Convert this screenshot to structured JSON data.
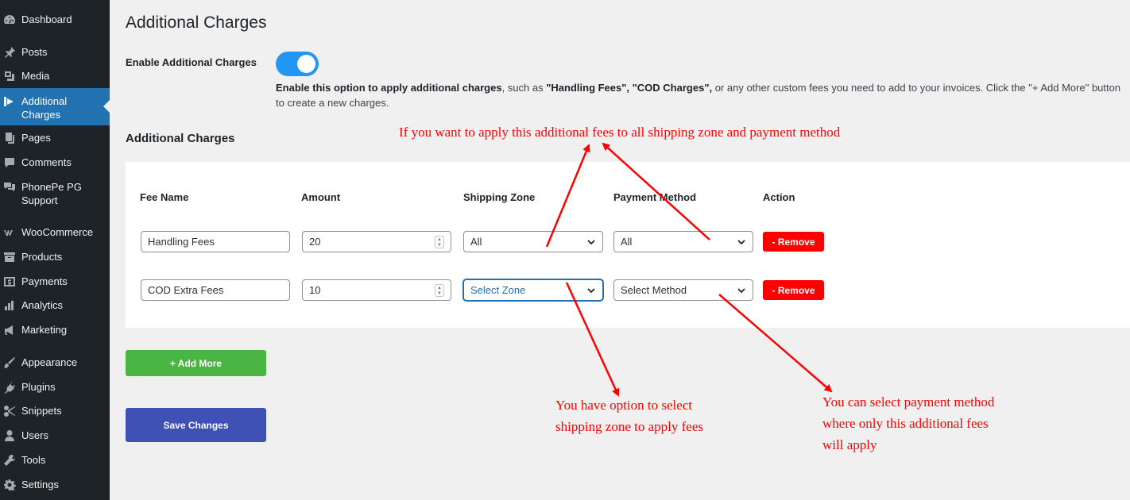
{
  "sidebar": {
    "items": [
      {
        "label": "Dashboard",
        "icon": "dashboard-icon"
      },
      {
        "label": "Posts",
        "icon": "pin-icon"
      },
      {
        "label": "Media",
        "icon": "media-icon"
      },
      {
        "label": "Additional Charges",
        "icon": "charges-icon",
        "active": true
      },
      {
        "label": "Pages",
        "icon": "pages-icon"
      },
      {
        "label": "Comments",
        "icon": "comment-icon"
      },
      {
        "label": "PhonePe PG Support",
        "icon": "comments-icon"
      },
      {
        "label": "WooCommerce",
        "icon": "woo-icon"
      },
      {
        "label": "Products",
        "icon": "archive-icon"
      },
      {
        "label": "Payments",
        "icon": "dollar-icon"
      },
      {
        "label": "Analytics",
        "icon": "chart-icon"
      },
      {
        "label": "Marketing",
        "icon": "megaphone-icon"
      },
      {
        "label": "Appearance",
        "icon": "brush-icon"
      },
      {
        "label": "Plugins",
        "icon": "plug-icon"
      },
      {
        "label": "Snippets",
        "icon": "scissors-icon"
      },
      {
        "label": "Users",
        "icon": "user-icon"
      },
      {
        "label": "Tools",
        "icon": "wrench-icon"
      },
      {
        "label": "Settings",
        "icon": "settings-icon"
      }
    ]
  },
  "page": {
    "title": "Additional Charges",
    "enable_label": "Enable Additional Charges",
    "toggle_on": true,
    "desc_b1": "Enable this option to apply additional charges",
    "desc_t1": ", such as ",
    "desc_b2": "\"Handling Fees\", \"COD Charges\",",
    "desc_t2": " or any other custom fees you need to add to your invoices. Click the \"+ Add More\" button to create a new charges.",
    "section_title": "Additional Charges"
  },
  "table": {
    "headers": {
      "fee_name": "Fee Name",
      "amount": "Amount",
      "zone": "Shipping Zone",
      "method": "Payment Method",
      "action": "Action"
    },
    "rows": [
      {
        "fee_name": "Handling Fees",
        "amount": "20",
        "zone": "All",
        "method": "All",
        "action": "- Remove"
      },
      {
        "fee_name": "COD Extra Fees",
        "amount": "10",
        "zone": "Select Zone",
        "method": "Select Method",
        "action": "- Remove"
      }
    ]
  },
  "buttons": {
    "add_more": "+ Add More",
    "save": "Save Changes"
  },
  "annotations": {
    "top": "If you want to apply this additional fees to all shipping zone and payment method",
    "zone_l1": "You have option to select",
    "zone_l2": "shipping zone to apply fees",
    "method_l1": "You can select payment method",
    "method_l2": "where only this additional fees",
    "method_l3": "will apply"
  },
  "colors": {
    "sidebar_bg": "#1d2327",
    "active_bg": "#2271b1",
    "toggle": "#2196f3",
    "remove": "#ff0000",
    "add": "#4bb543",
    "save": "#3f51b5",
    "annotation": "#ff0000"
  }
}
